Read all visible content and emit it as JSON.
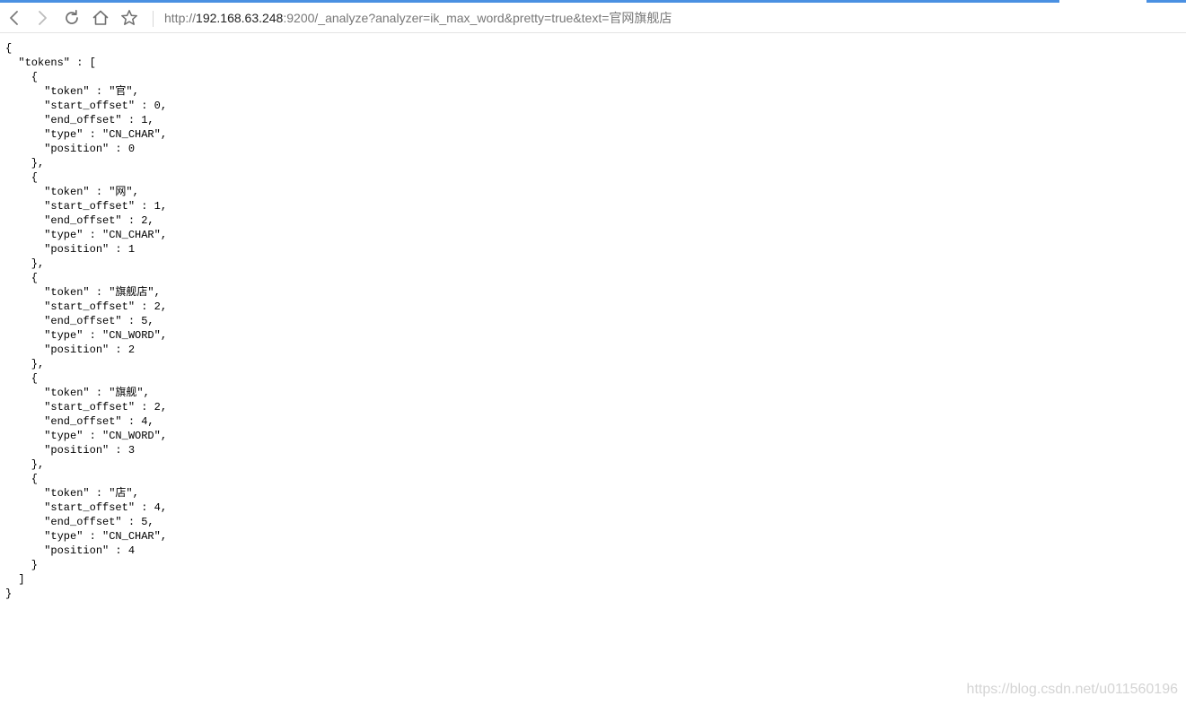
{
  "browser": {
    "load_progress": 0.893,
    "accent_color": "#4a90e2",
    "buttons": {
      "back_icon": "chevron-left-icon",
      "forward_icon": "chevron-right-icon",
      "reload_icon": "reload-icon",
      "home_icon": "home-icon",
      "bookmark_icon": "star-icon"
    },
    "url": {
      "scheme": "http://",
      "host": "192.168.63.248",
      "rest": ":9200/_analyze?analyzer=ik_max_word&pretty=true&text=官网旗舰店"
    }
  },
  "json_lines": [
    "{",
    "  \"tokens\" : [",
    "    {",
    "      \"token\" : \"官\",",
    "      \"start_offset\" : 0,",
    "      \"end_offset\" : 1,",
    "      \"type\" : \"CN_CHAR\",",
    "      \"position\" : 0",
    "    },",
    "    {",
    "      \"token\" : \"网\",",
    "      \"start_offset\" : 1,",
    "      \"end_offset\" : 2,",
    "      \"type\" : \"CN_CHAR\",",
    "      \"position\" : 1",
    "    },",
    "    {",
    "      \"token\" : \"旗舰店\",",
    "      \"start_offset\" : 2,",
    "      \"end_offset\" : 5,",
    "      \"type\" : \"CN_WORD\",",
    "      \"position\" : 2",
    "    },",
    "    {",
    "      \"token\" : \"旗舰\",",
    "      \"start_offset\" : 2,",
    "      \"end_offset\" : 4,",
    "      \"type\" : \"CN_WORD\",",
    "      \"position\" : 3",
    "    },",
    "    {",
    "      \"token\" : \"店\",",
    "      \"start_offset\" : 4,",
    "      \"end_offset\" : 5,",
    "      \"type\" : \"CN_CHAR\",",
    "      \"position\" : 4",
    "    }",
    "  ]",
    "}"
  ],
  "watermark": "https://blog.csdn.net/u011560196"
}
